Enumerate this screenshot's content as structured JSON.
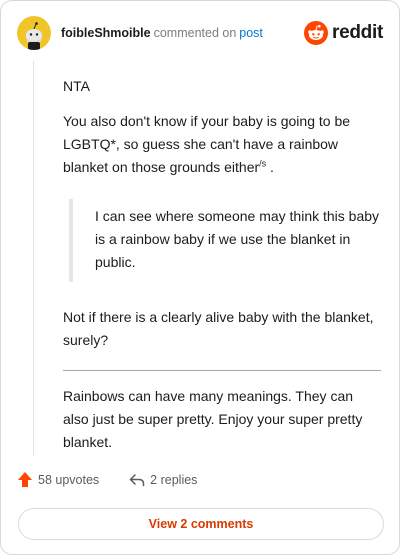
{
  "header": {
    "username": "foibleShmoible",
    "action": "commented on",
    "post_link": "post",
    "brand": "reddit"
  },
  "comment": {
    "line1": "NTA",
    "para2_text": "You also don't know if your baby is going to be LGBTQ*, so guess she can't have a rainbow blanket on those grounds either",
    "para2_sup": "/s",
    "para2_end": " .",
    "quote": "I can see where someone may think this baby is a rainbow baby if we use the blanket in public.",
    "reply_to_quote": "Not if there is a clearly alive baby with the blanket, surely?",
    "para_after_divider": "Rainbows can have many meanings. They can also just be super pretty. Enjoy your super pretty blanket."
  },
  "footer": {
    "upvotes_label": "58 upvotes",
    "replies_label": "2 replies",
    "view_comments_label": "View 2 comments"
  },
  "colors": {
    "upvote": "#ff4500",
    "link": "#0079d3",
    "view_button_text": "#d93a00"
  }
}
